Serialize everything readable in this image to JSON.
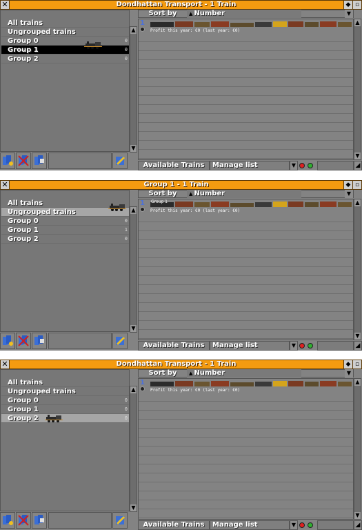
{
  "windows": [
    {
      "title": "Dondhattan Transport - 1 Train",
      "groups": [
        {
          "label": "All trains",
          "count": ""
        },
        {
          "label": "Ungrouped trains",
          "count": ""
        },
        {
          "label": "Group 0",
          "count": "0"
        },
        {
          "label": "Group 1",
          "count": "0"
        },
        {
          "label": "Group 2",
          "count": "0"
        }
      ],
      "selected_group": "Group 1",
      "vehicle": {
        "number": "1",
        "group_name": "",
        "profit": "Profit this year: €0 (last year: €0)"
      }
    },
    {
      "title": "Group 1 - 1 Train",
      "groups": [
        {
          "label": "All trains",
          "count": ""
        },
        {
          "label": "Ungrouped trains",
          "count": ""
        },
        {
          "label": "Group 0",
          "count": "0"
        },
        {
          "label": "Group 1",
          "count": "1"
        },
        {
          "label": "Group 2",
          "count": "0"
        }
      ],
      "selected_group": "Ungrouped trains",
      "vehicle": {
        "number": "1",
        "group_name": "Group 1",
        "profit": "Profit this year: €0 (last year: €0)"
      }
    },
    {
      "title": "Dondhattan Transport - 1 Train",
      "groups": [
        {
          "label": "All trains",
          "count": ""
        },
        {
          "label": "Ungrouped trains",
          "count": ""
        },
        {
          "label": "Group 0",
          "count": "0"
        },
        {
          "label": "Group 1",
          "count": "0"
        },
        {
          "label": "Group 2",
          "count": "0"
        }
      ],
      "selected_group": "Group 2",
      "vehicle": {
        "number": "1",
        "group_name": "",
        "profit": "Profit this year: €0 (last year: €0)"
      }
    }
  ],
  "labels": {
    "close_glyph": "✕",
    "sort_by": "Sort by",
    "sort_criterion": "Number",
    "available": "Available Trains",
    "manage": "Manage list"
  },
  "colors": {
    "titlebar": "#f49b10",
    "panel": "#838383",
    "selected": "#000000"
  }
}
